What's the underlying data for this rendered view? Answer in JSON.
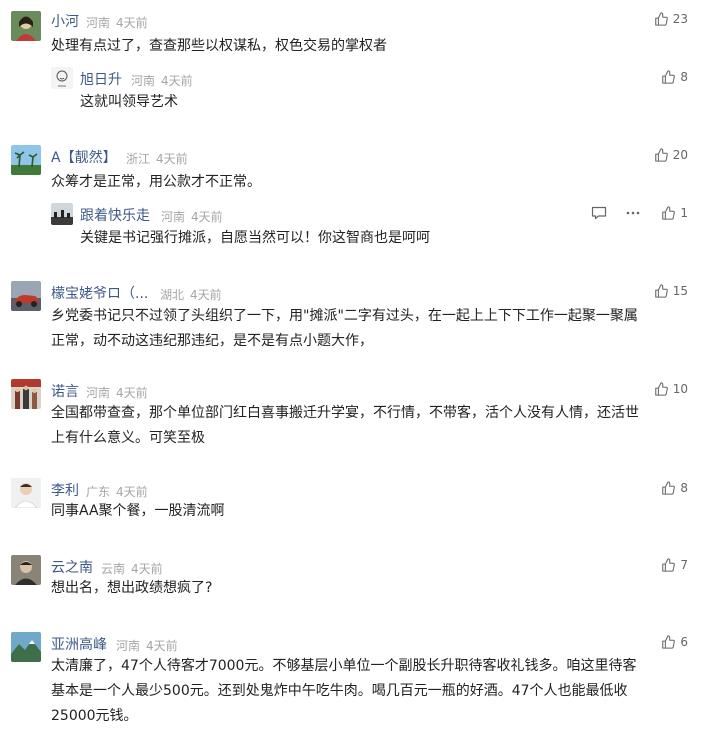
{
  "comments": [
    {
      "name": "小河",
      "region": "河南",
      "time": "4天前",
      "likes": "23",
      "text": "处理有点过了，查查那些以权谋私，权色交易的掌权者",
      "reply": {
        "name": "旭日升",
        "region": "河南",
        "time": "4天前",
        "likes": "8",
        "text": "这就叫领导艺术"
      }
    },
    {
      "name": "A【靓然】",
      "region": "浙江",
      "time": "4天前",
      "likes": "20",
      "text": "众筹才是正常，用公款才不正常。",
      "reply": {
        "name": "跟着快乐走",
        "region": "河南",
        "time": "4天前",
        "likes": "1",
        "text": "关键是书记强行摊派，自愿当然可以！你这智商也是呵呵"
      }
    },
    {
      "name": "檬宝姥爷ロ（...",
      "region": "湖北",
      "time": "4天前",
      "likes": "15",
      "text_lines": [
        "乡党委书记只不过领了头组织了一下，用\"摊派\"二字有过头，在一起上上下下工作一起聚一聚属",
        "正常，动不动这违纪那违纪，是不是有点小题大作，"
      ]
    },
    {
      "name": "诺言",
      "region": "河南",
      "time": "4天前",
      "likes": "10",
      "text_lines": [
        "全国都带查查，那个单位部门红白喜事搬迁升学宴，不行情，不带客，活个人没有人情，还活世",
        "上有什么意义。可笑至极"
      ]
    },
    {
      "name": "李利",
      "region": "广东",
      "time": "4天前",
      "likes": "8",
      "text": "同事AA聚个餐，一股清流啊"
    },
    {
      "name": "云之南",
      "region": "云南",
      "time": "4天前",
      "likes": "7",
      "text": "想出名，想出政绩想疯了?"
    },
    {
      "name": "亚洲高峰",
      "region": "河南",
      "time": "4天前",
      "likes": "6",
      "text_lines": [
        "太清廉了，47个人待客才7000元。不够基层小单位一个副股长升职待客收礼钱多。咱这里待客",
        "基本是一个人最少500元。还到处鬼炸中午吃牛肉。喝几百元一瓶的好酒。47个人也能最低收",
        "25000元钱。"
      ]
    }
  ],
  "colors": {
    "name": "#3e5a8a",
    "meta": "#a6a6a6",
    "text": "#222222"
  },
  "icons": {
    "like": "thumbs-up-icon",
    "reply": "comment-icon",
    "more": "more-icon"
  }
}
